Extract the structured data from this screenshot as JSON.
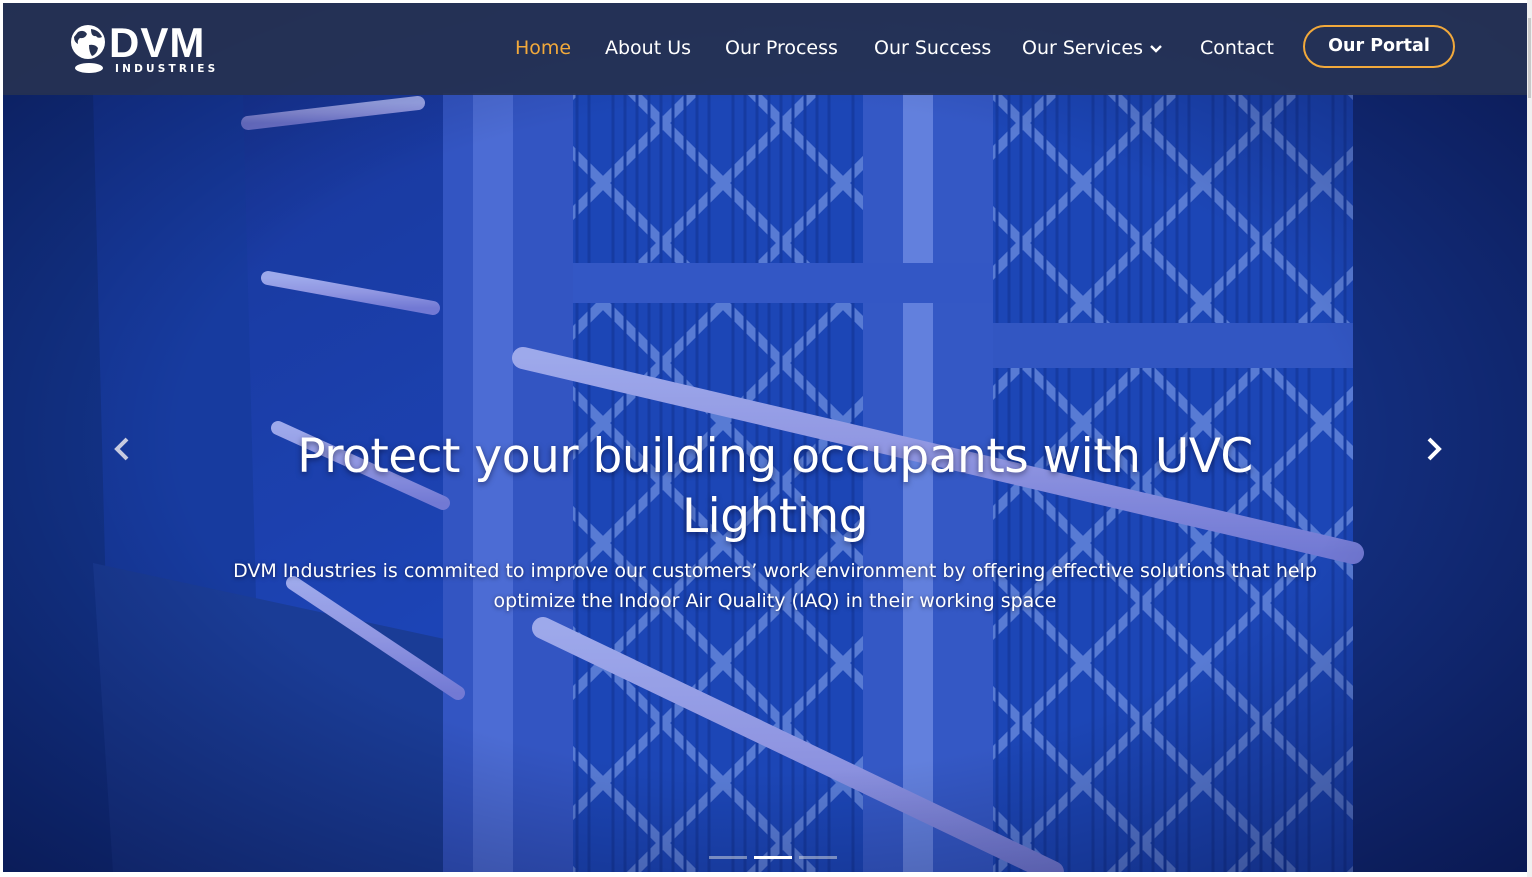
{
  "brand": {
    "name": "DVM",
    "tagline": "INDUSTRIES"
  },
  "nav": {
    "items": [
      {
        "label": "Home",
        "active": true
      },
      {
        "label": "About Us",
        "active": false
      },
      {
        "label": "Our Process",
        "active": false
      },
      {
        "label": "Our Success",
        "active": false
      },
      {
        "label": "Our Services",
        "active": false,
        "has_dropdown": true
      },
      {
        "label": "Contact",
        "active": false
      }
    ],
    "portal_button": "Our Portal"
  },
  "hero": {
    "title": "Protect your building occupants with UVC Lighting",
    "subtitle": "DVM Industries is commited to improve our customers’ work environment by offering effective solutions that help optimize the Indoor Air Quality (IAQ) in their working space",
    "slide_count": 3,
    "active_slide": 2,
    "prev_icon": "chevron-left-icon",
    "next_icon": "chevron-right-icon"
  },
  "colors": {
    "accent": "#f2a93b",
    "header_bg": "#263252",
    "hero_tint": "#1a3fa8",
    "text": "#ffffff"
  }
}
